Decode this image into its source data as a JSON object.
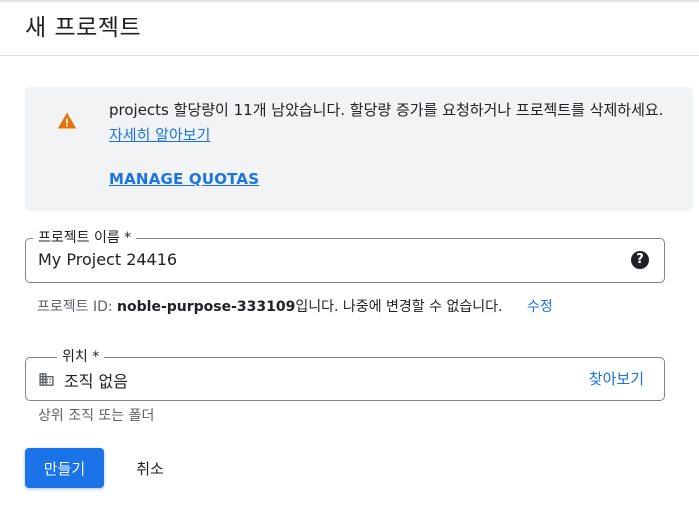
{
  "header": {
    "title": "새 프로젝트"
  },
  "notice": {
    "icon": "warning-icon",
    "text": "projects 할당량이 11개 남았습니다. 할당량 증가를 요청하거나 프로젝트를 삭제하세요.",
    "learn_more_link": "자세히 알아보기",
    "manage_quotas": "MANAGE QUOTAS"
  },
  "project_name": {
    "label": "프로젝트 이름 *",
    "value": "My Project 24416",
    "help_icon": "help-icon"
  },
  "project_id": {
    "prefix": "프로젝트 ID: ",
    "id": "noble-purpose-333109",
    "suffix": "입니다. 나중에 변경할 수 없습니다.",
    "edit_link": "수정"
  },
  "location": {
    "label": "위치 *",
    "icon": "building-icon",
    "value": "조직 없음",
    "browse_link": "찾아보기",
    "hint": "상위 조직 또는 폴더"
  },
  "actions": {
    "create_label": "만들기",
    "cancel_label": "취소"
  },
  "colors": {
    "accent": "#1a73e8",
    "warning": "#e8710a",
    "notice_bg": "#f1f3f4"
  }
}
